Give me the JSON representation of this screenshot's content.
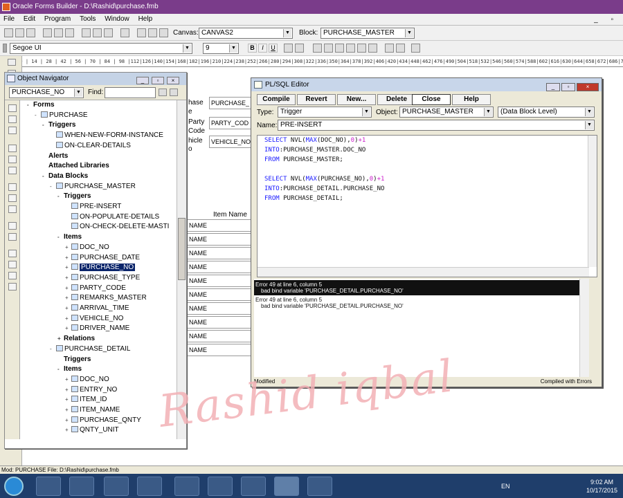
{
  "window": {
    "title": "Oracle Forms Builder - D:\\Rashid\\purchase.fmb"
  },
  "menu": [
    "File",
    "Edit",
    "Program",
    "Tools",
    "Window",
    "Help"
  ],
  "toolbar": {
    "canvas_label": "Canvas:",
    "canvas_value": "CANVAS2",
    "block_label": "Block:",
    "block_value": "PURCHASE_MASTER",
    "font_value": "Segoe UI",
    "size_value": "9"
  },
  "ruler": "| 0 | 14 | 28 | 42 | 56 | 70 | 84 | 98 |112|126|140|154|168|182|196|210|224|238|252|266|280|294|308|322|336|350|364|378|392|406|420|434|448|462|476|490|504|518|532|546|560|574|588|602|616|630|644|658|672|686|700|714|728|742|756|770",
  "navigator": {
    "title": "Object Navigator",
    "module_value": "PURCHASE_NO",
    "find_label": "Find:",
    "tree": [
      {
        "label": "Forms",
        "indent": 0,
        "toggle": "-",
        "bold": true,
        "icon": false
      },
      {
        "label": "PURCHASE",
        "indent": 1,
        "toggle": "-",
        "bold": false,
        "icon": true
      },
      {
        "label": "Triggers",
        "indent": 2,
        "toggle": "-",
        "bold": true,
        "icon": false
      },
      {
        "label": "WHEN-NEW-FORM-INSTANCE",
        "indent": 3,
        "toggle": "",
        "bold": false,
        "icon": true
      },
      {
        "label": "ON-CLEAR-DETAILS",
        "indent": 3,
        "toggle": "",
        "bold": false,
        "icon": true
      },
      {
        "label": "Alerts",
        "indent": 2,
        "toggle": "",
        "bold": true,
        "icon": false
      },
      {
        "label": "Attached Libraries",
        "indent": 2,
        "toggle": "",
        "bold": true,
        "icon": false
      },
      {
        "label": "Data Blocks",
        "indent": 2,
        "toggle": "-",
        "bold": true,
        "icon": false
      },
      {
        "label": "PURCHASE_MASTER",
        "indent": 3,
        "toggle": "-",
        "bold": false,
        "icon": true
      },
      {
        "label": "Triggers",
        "indent": 4,
        "toggle": "-",
        "bold": true,
        "icon": false
      },
      {
        "label": "PRE-INSERT",
        "indent": 5,
        "toggle": "",
        "bold": false,
        "icon": true
      },
      {
        "label": "ON-POPULATE-DETAILS",
        "indent": 5,
        "toggle": "",
        "bold": false,
        "icon": true
      },
      {
        "label": "ON-CHECK-DELETE-MASTI",
        "indent": 5,
        "toggle": "",
        "bold": false,
        "icon": true
      },
      {
        "label": "Items",
        "indent": 4,
        "toggle": "-",
        "bold": true,
        "icon": false
      },
      {
        "label": "DOC_NO",
        "indent": 5,
        "toggle": "+",
        "bold": false,
        "icon": true
      },
      {
        "label": "PURCHASE_DATE",
        "indent": 5,
        "toggle": "+",
        "bold": false,
        "icon": true
      },
      {
        "label": "PURCHASE_NO",
        "indent": 5,
        "toggle": "+",
        "bold": false,
        "icon": true,
        "selected": true
      },
      {
        "label": "PURCHASE_TYPE",
        "indent": 5,
        "toggle": "+",
        "bold": false,
        "icon": true
      },
      {
        "label": "PARTY_CODE",
        "indent": 5,
        "toggle": "+",
        "bold": false,
        "icon": true
      },
      {
        "label": "REMARKS_MASTER",
        "indent": 5,
        "toggle": "+",
        "bold": false,
        "icon": true
      },
      {
        "label": "ARRIVAL_TIME",
        "indent": 5,
        "toggle": "+",
        "bold": false,
        "icon": true
      },
      {
        "label": "VEHICLE_NO",
        "indent": 5,
        "toggle": "+",
        "bold": false,
        "icon": true
      },
      {
        "label": "DRIVER_NAME",
        "indent": 5,
        "toggle": "+",
        "bold": false,
        "icon": true
      },
      {
        "label": "Relations",
        "indent": 4,
        "toggle": "+",
        "bold": true,
        "icon": false
      },
      {
        "label": "PURCHASE_DETAIL",
        "indent": 3,
        "toggle": "-",
        "bold": false,
        "icon": true
      },
      {
        "label": "Triggers",
        "indent": 4,
        "toggle": "",
        "bold": true,
        "icon": false
      },
      {
        "label": "Items",
        "indent": 4,
        "toggle": "-",
        "bold": true,
        "icon": false
      },
      {
        "label": "DOC_NO",
        "indent": 5,
        "toggle": "+",
        "bold": false,
        "icon": true
      },
      {
        "label": "ENTRY_NO",
        "indent": 5,
        "toggle": "+",
        "bold": false,
        "icon": true
      },
      {
        "label": "ITEM_ID",
        "indent": 5,
        "toggle": "+",
        "bold": false,
        "icon": true
      },
      {
        "label": "ITEM_NAME",
        "indent": 5,
        "toggle": "+",
        "bold": false,
        "icon": true
      },
      {
        "label": "PURCHASE_QNTY",
        "indent": 5,
        "toggle": "+",
        "bold": false,
        "icon": true
      },
      {
        "label": "QNTY_UNIT",
        "indent": 5,
        "toggle": "+",
        "bold": false,
        "icon": true
      }
    ]
  },
  "layout_fragments": {
    "lbl1": "hase",
    "lbl2": "e",
    "lbl3": "Party",
    "lbl4": "Code",
    "lbl5": "hicle",
    "lbl6": "o",
    "fld1": "PURCHASE_",
    "fld2": "PARTY_COD",
    "fld3": "VEHICLE_NO",
    "col_header": "Item Name",
    "rows": [
      "NAME",
      "NAME",
      "NAME",
      "NAME",
      "NAME",
      "NAME",
      "NAME",
      "NAME",
      "NAME",
      "NAME"
    ]
  },
  "plsql": {
    "title": "PL/SQL Editor",
    "buttons": [
      "Compile",
      "Revert",
      "New...",
      "Delete",
      "Close",
      "Help"
    ],
    "type_label": "Type:",
    "type_value": "Trigger",
    "object_label": "Object:",
    "object_value": "PURCHASE_MASTER",
    "level_value": "(Data Block Level)",
    "name_label": "Name:",
    "name_value": "PRE-INSERT",
    "code": [
      "SELECT NVL(MAX(DOC_NO),0)+1",
      "INTO:PURCHASE_MASTER.DOC_NO",
      "FROM PURCHASE_MASTER;",
      "",
      "SELECT NVL(MAX(PURCHASE_NO),0)+1",
      "INTO:PURCHASE_DETAIL.PURCHASE_NO",
      "FROM PURCHASE_DETAIL;"
    ],
    "error_line1": "Error 49 at line 6, column 5",
    "error_line2": "bad bind variable 'PURCHASE_DETAIL.PURCHASE_NO'",
    "status_left": "Modified",
    "status_right": "Compiled with Errors"
  },
  "watermark": "Rashid iqbal",
  "statusbar": "Mod: PURCHASE  File: D:\\Rashid\\purchase.fmb",
  "taskbar": {
    "lang": "EN",
    "time": "9:02 AM",
    "date": "10/17/2015"
  }
}
